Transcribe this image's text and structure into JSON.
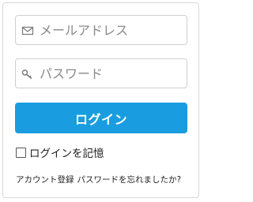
{
  "login_form": {
    "email": {
      "placeholder": "メールアドレス",
      "value": "",
      "icon": "envelope-icon"
    },
    "password": {
      "placeholder": "パスワード",
      "value": "",
      "icon": "key-icon"
    },
    "login_button_label": "ログイン",
    "remember_me": {
      "label": "ログインを記憶",
      "checked": false
    },
    "links": {
      "register": "アカウント登録",
      "forgot_password": "パスワードを忘れましたか?"
    },
    "colors": {
      "primary": "#1a9de0",
      "border": "#cfcfcf",
      "placeholder_text": "#8a8a8a"
    }
  }
}
